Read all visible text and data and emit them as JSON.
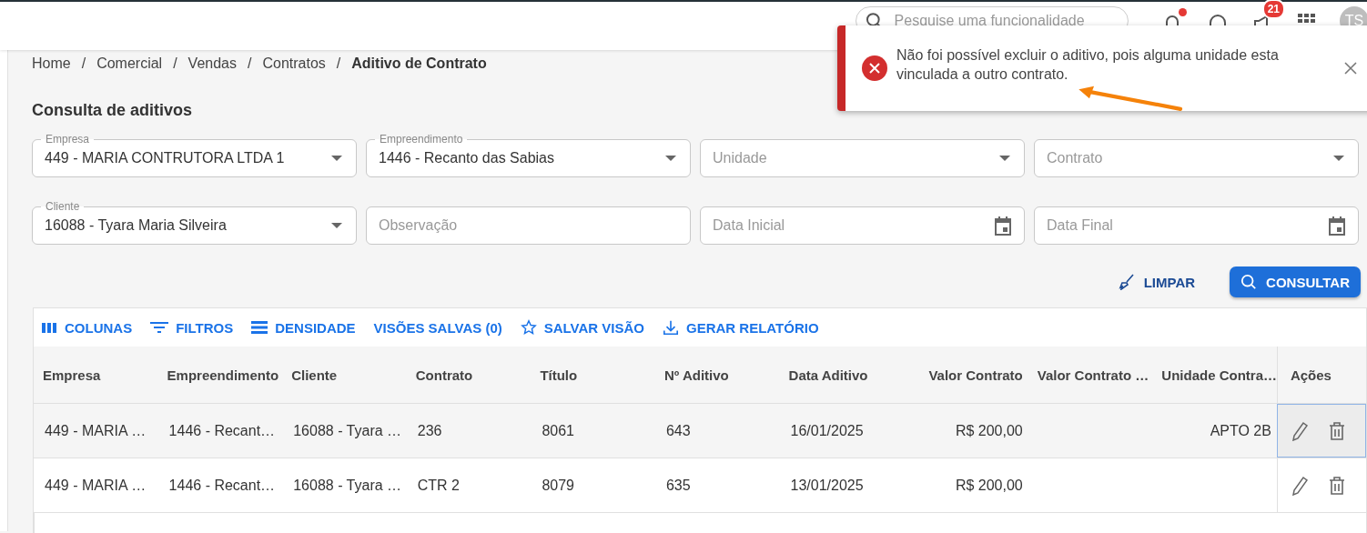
{
  "header": {
    "search": {
      "placeholder": "Pesquise uma funcionalidade"
    },
    "alert_dot": true,
    "badge": "21",
    "avatar": "TS"
  },
  "toast": {
    "message": "Não foi possível excluir o aditivo, pois alguma unidade esta vinculada a outro contrato."
  },
  "breadcrumb": [
    {
      "label": "Home",
      "current": false
    },
    {
      "separator": "/",
      "label": "Comercial",
      "current": false
    },
    {
      "separator": "/",
      "label": "Vendas",
      "current": false
    },
    {
      "separator": "/",
      "label": "Contratos",
      "current": false
    },
    {
      "separator": "/",
      "label": "Aditivo de Contrato",
      "current": true
    }
  ],
  "page_title": "Consulta de aditivos",
  "filters": [
    {
      "kind": "select",
      "label": "Empresa",
      "value": "449 - MARIA CONTRUTORA LTDA 1"
    },
    {
      "kind": "select",
      "label": "Empreendimento",
      "value": "1446 - Recanto das Sabias"
    },
    {
      "kind": "select",
      "placeholder": "Unidade"
    },
    {
      "kind": "select",
      "placeholder": "Contrato"
    },
    {
      "kind": "select",
      "label": "Cliente",
      "value": "16088 - Tyara Maria Silveira"
    },
    {
      "kind": "text",
      "placeholder": "Observação"
    },
    {
      "kind": "date",
      "placeholder": "Data Inicial"
    },
    {
      "kind": "date",
      "placeholder": "Data Final"
    }
  ],
  "actions": {
    "clear": "LIMPAR",
    "search": "CONSULTAR"
  },
  "toolbar": [
    "COLUNAS",
    "FILTROS",
    "DENSIDADE",
    "VISÕES SALVAS (0)",
    "SALVAR VISÃO",
    "GERAR RELATÓRIO"
  ],
  "table": {
    "columns": [
      "Empresa",
      "Empreendimento",
      "Cliente",
      "Contrato",
      "Título",
      "Nº Aditivo",
      "Data Aditivo",
      "Valor Contrato",
      "Valor Contrato …",
      "Unidade Contra…"
    ],
    "actions_column": "Ações",
    "rows": [
      {
        "selected": true,
        "cells": [
          "449 - MARIA …",
          "1446 - Recant…",
          "16088 - Tyara …",
          "236",
          "8061",
          "643",
          "16/01/2025",
          "R$ 200,00",
          "",
          "APTO 2B"
        ]
      },
      {
        "selected": false,
        "cells": [
          "449 - MARIA …",
          "1446 - Recant…",
          "16088 - Tyara …",
          "CTR 2",
          "8079",
          "635",
          "13/01/2025",
          "R$ 200,00",
          "",
          ""
        ]
      }
    ]
  }
}
